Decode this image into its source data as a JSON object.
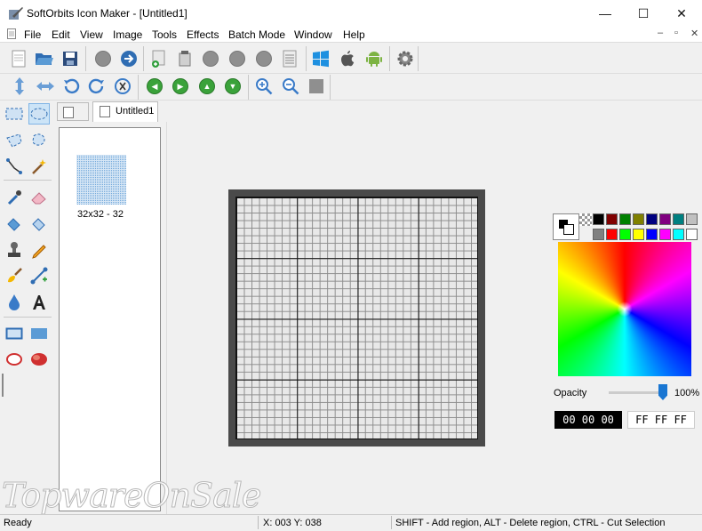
{
  "window": {
    "title": "SoftOrbits Icon Maker - [Untitled1]",
    "minimize": "—",
    "maximize": "☐",
    "close": "✕"
  },
  "menu": [
    "File",
    "Edit",
    "View",
    "Image",
    "Tools",
    "Effects",
    "Batch Mode",
    "Window",
    "Help"
  ],
  "mdi_controls": [
    "–",
    "▫",
    "✕"
  ],
  "tabs": {
    "document": "Untitled1"
  },
  "thumbnail": {
    "label": "32x32 - 32"
  },
  "palette": {
    "row1": [
      "#000000",
      "#800000",
      "#008000",
      "#808000",
      "#000080",
      "#800080",
      "#008080",
      "#c0c0c0"
    ],
    "row2": [
      "#808080",
      "#ff0000",
      "#00ff00",
      "#ffff00",
      "#0000ff",
      "#ff00ff",
      "#00ffff",
      "#ffffff"
    ]
  },
  "colors": {
    "foreground": "#000000",
    "background": "#ffffff"
  },
  "opacity": {
    "label": "Opacity",
    "value": "100%"
  },
  "hex": {
    "foreground": "00 00 00",
    "background": "FF FF FF"
  },
  "status": {
    "ready": "Ready",
    "coords": "X: 003 Y: 038",
    "hint": "SHIFT - Add region, ALT - Delete region, CTRL - Cut Selection"
  },
  "watermark": "TopwareOnSale"
}
